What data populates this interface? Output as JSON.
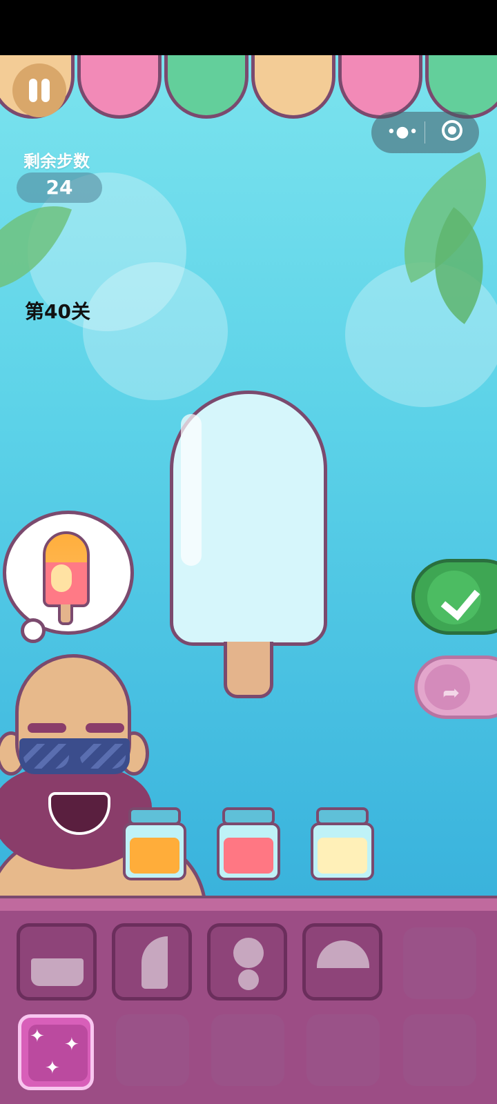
{
  "hud": {
    "steps_label": "剩余步数",
    "steps_value": "24",
    "level_label": "第40关"
  },
  "capsule": {
    "more_icon": "more-dots-icon",
    "close_icon": "target-close-icon"
  },
  "awning": {
    "colors": [
      "#f3cc96",
      "#f28ab7",
      "#63cf9b",
      "#f3cc96",
      "#f28ab7",
      "#63cf9b"
    ]
  },
  "target_popsicle": {
    "colors": [
      "#ffae3d",
      "#ff7a86",
      "#ffe2a3"
    ]
  },
  "main_popsicle": {
    "color": "#d6f6fb"
  },
  "jars": [
    {
      "name": "orange-jar",
      "color": "#ffad3a"
    },
    {
      "name": "pink-jar",
      "color": "#ff7783"
    },
    {
      "name": "cream-jar",
      "color": "#fff0b8"
    }
  ],
  "buttons": {
    "confirm_icon": "checkmark-icon",
    "redo_icon": "redo-arrow-icon",
    "pause_icon": "pause-icon"
  },
  "tools": {
    "shapes": [
      "bottom-rect-mold",
      "half-capsule-mold",
      "double-circle-mold",
      "semicircle-mold"
    ],
    "magic_icon": "sparkles-icon"
  }
}
